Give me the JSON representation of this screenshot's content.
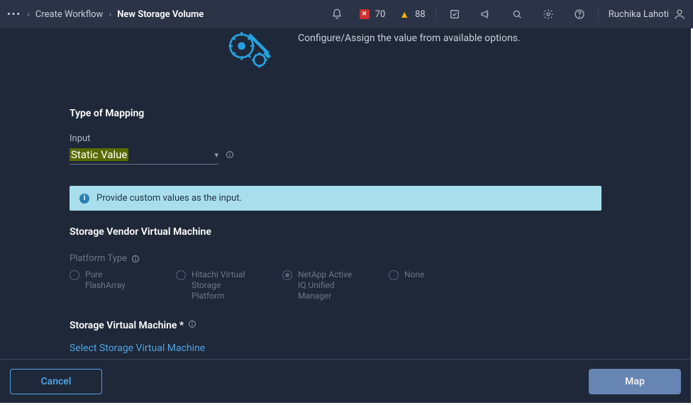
{
  "header": {
    "breadcrumbs": [
      "Create Workflow",
      "New Storage Volume"
    ],
    "alerts": {
      "error_count": "70",
      "warning_count": "88"
    },
    "user_name": "Ruchika Lahoti"
  },
  "hero": {
    "subtitle": "Configure/Assign the value from available options."
  },
  "form": {
    "type_of_mapping_label": "Type of Mapping",
    "input_label": "Input",
    "input_value": "Static Value",
    "banner_text": "Provide custom values as the input.",
    "vendor_label": "Storage Vendor Virtual Machine",
    "platform_type_label": "Platform Type",
    "platform_options": [
      "Pure FlashArray",
      "Hitachi Virtual Storage Platform",
      "NetApp Active IQ Unified Manager",
      "None"
    ],
    "svm_label": "Storage Virtual Machine *",
    "svm_link": "Select Storage Virtual Machine"
  },
  "footer": {
    "cancel": "Cancel",
    "map": "Map"
  }
}
